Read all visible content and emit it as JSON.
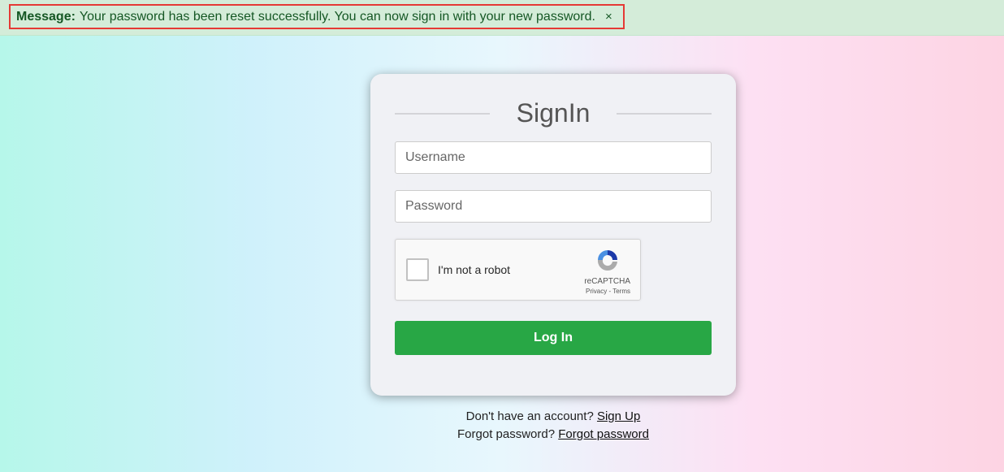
{
  "banner": {
    "label": "Message:",
    "text": "Your password has been reset successfully. You can now sign in with your new password.",
    "close": "×"
  },
  "form": {
    "title": "SignIn",
    "username_placeholder": "Username",
    "password_placeholder": "Password",
    "login": "Log In"
  },
  "captcha": {
    "label": "I'm not a robot",
    "brand": "reCAPTCHA",
    "links": "Privacy - Terms"
  },
  "footer": {
    "signup_prompt": "Don't have an account?",
    "signup_link": "Sign Up",
    "forgot_prompt": "Forgot password?",
    "forgot_link": "Forgot password"
  }
}
